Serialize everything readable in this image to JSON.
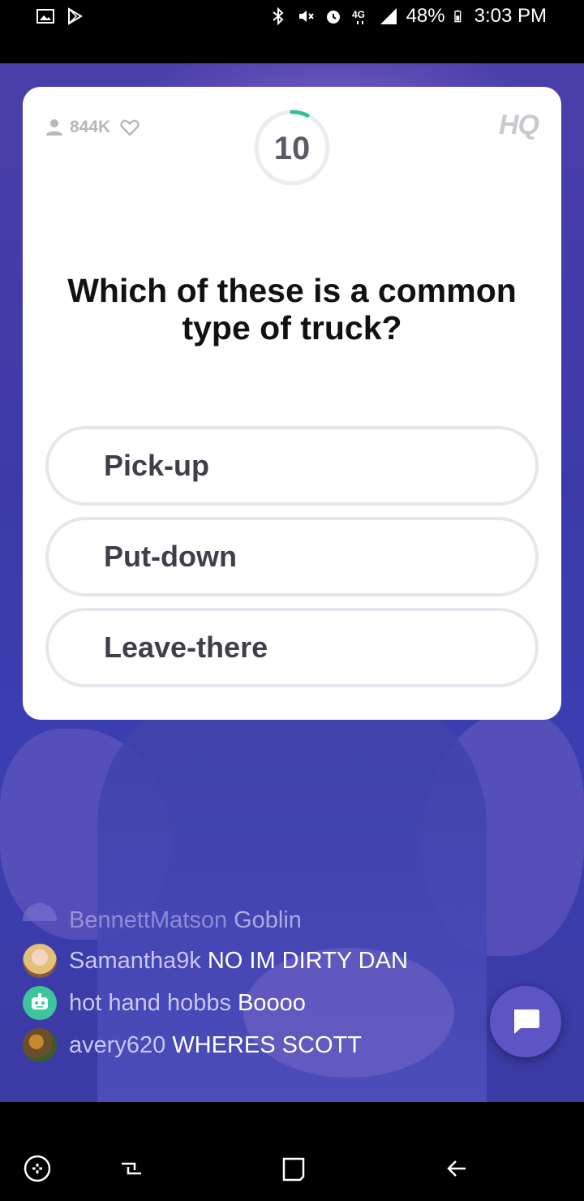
{
  "status_bar": {
    "battery": "48%",
    "time": "3:03 PM",
    "left_icons": [
      "gallery-icon",
      "play-store-icon"
    ],
    "right_icons": [
      "bluetooth-icon",
      "mute-icon",
      "alarm-icon",
      "4g-lte-icon",
      "signal-icon",
      "battery-icon"
    ]
  },
  "card": {
    "viewer_count": "844K",
    "timer": "10",
    "logo": "HQ",
    "question": "Which of these is a common type of truck?",
    "answers": [
      {
        "label": "Pick-up"
      },
      {
        "label": "Put-down"
      },
      {
        "label": "Leave-there"
      }
    ],
    "timer_color": "#34c38f"
  },
  "chat": {
    "messages": [
      {
        "username": "BennettMatson",
        "text": "Goblin"
      },
      {
        "username": "Samantha9k",
        "text": "NO IM DIRTY DAN"
      },
      {
        "username": "hot hand hobbs",
        "text": "Boooo"
      },
      {
        "username": "avery620",
        "text": "WHERES SCOTT"
      }
    ]
  },
  "colors": {
    "accent": "#5d54c6",
    "username": "#c9c6f2",
    "timer_progress": "#34c38f"
  }
}
